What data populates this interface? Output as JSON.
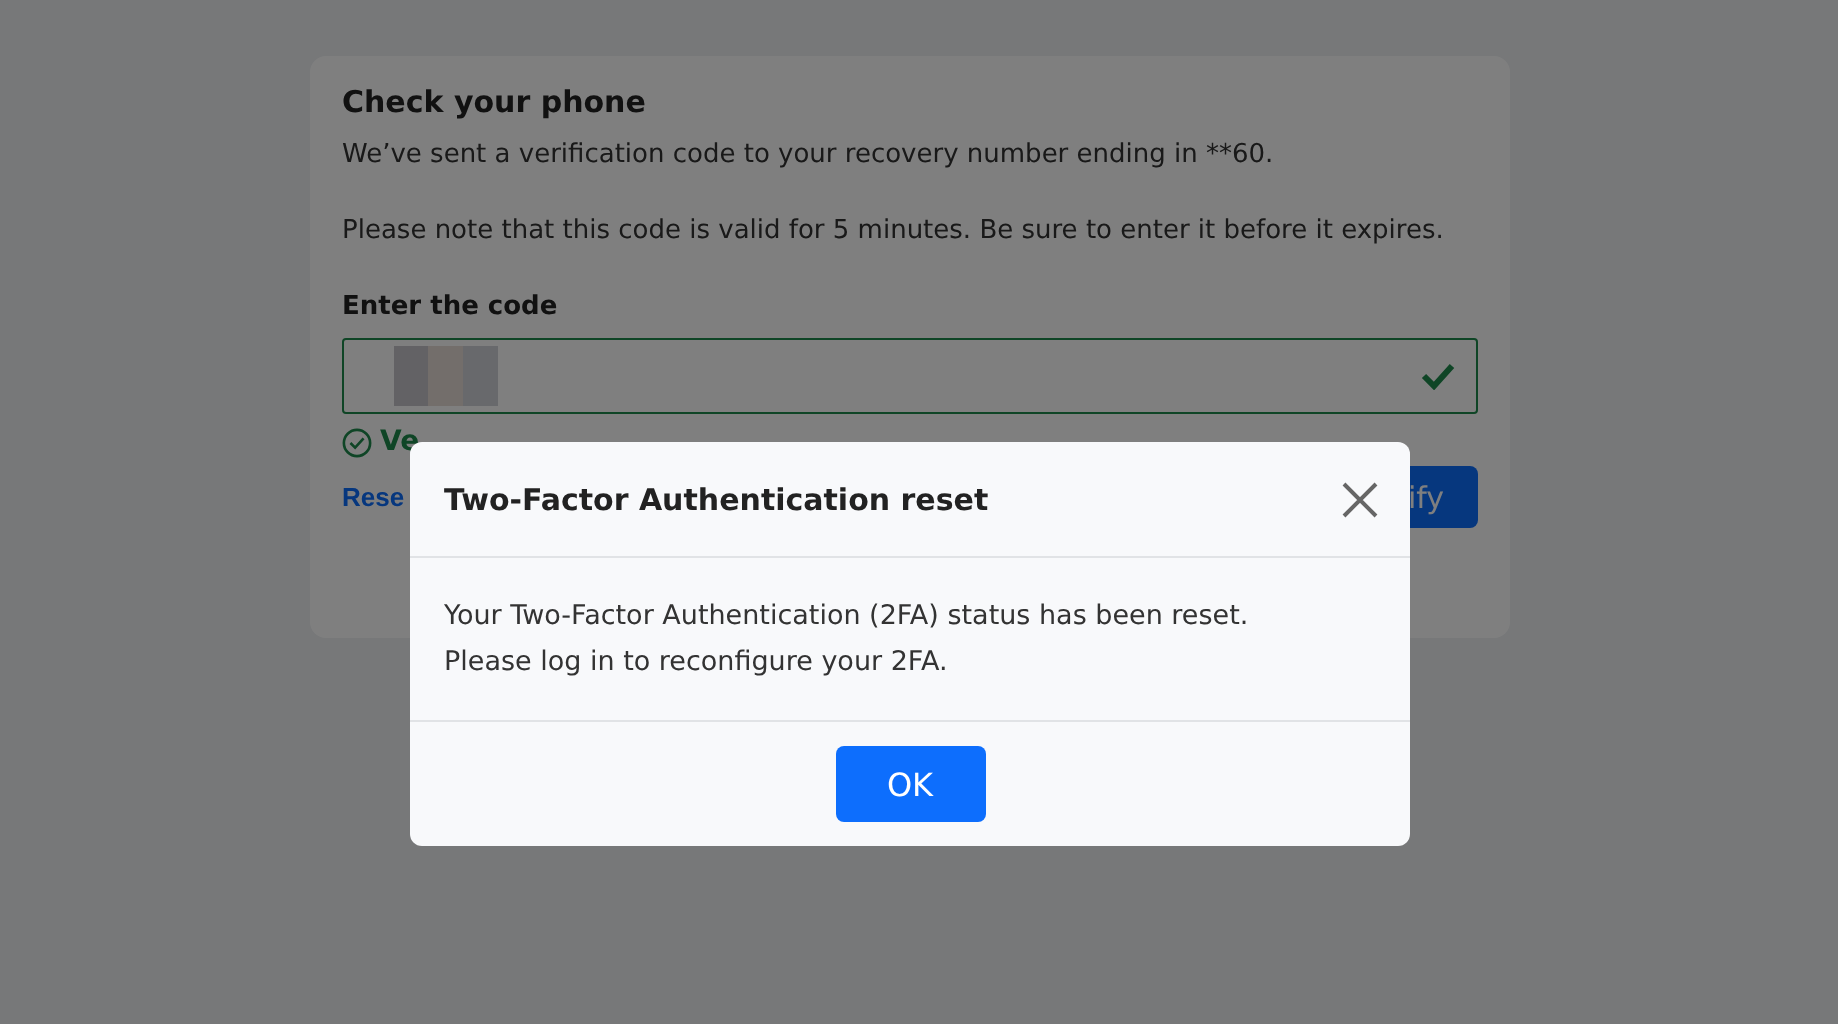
{
  "card": {
    "title": "Check your phone",
    "message": "We’ve sent a verification code to your recovery number ending in **60.",
    "note": "Please note that this code is valid for 5 minutes. Be sure to enter it before it expires.",
    "field_label": "Enter the code",
    "code_field": {
      "verified": true
    },
    "status": "Ve",
    "resend_link": "Rese",
    "verify_button": "ify"
  },
  "dialog": {
    "title": "Two-Factor Authentication reset",
    "lines": [
      "Your Two-Factor Authentication (2FA) status has been reset.",
      "Please log in to reconfigure your 2FA."
    ],
    "ok_button": "OK"
  }
}
